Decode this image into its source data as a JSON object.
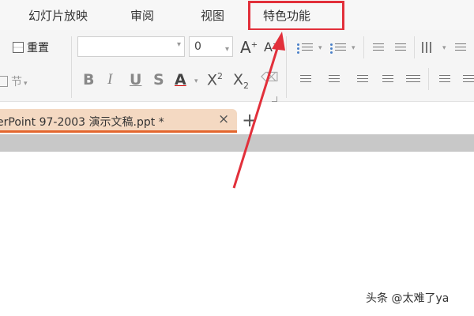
{
  "menu": {
    "tabs": [
      "幻灯片放映",
      "审阅",
      "视图",
      "特色功能"
    ],
    "highlighted_tab_index": 3
  },
  "ribbon": {
    "reset_label": "重置",
    "section_label": "节",
    "font_name": "",
    "font_size": "0",
    "grow_label": "A",
    "shrink_label": "A",
    "bold": "B",
    "italic": "I",
    "underline": "U",
    "strike": "S",
    "font_color": "A",
    "superscript_base": "X",
    "superscript_mark": "2",
    "subscript_base": "X",
    "subscript_mark": "2"
  },
  "document": {
    "tab_title": "erPoint 97-2003 演示文稿.ppt *",
    "close_glyph": "×",
    "new_tab_glyph": "+"
  },
  "watermark": "头条 @太难了ya",
  "colors": {
    "highlight": "#e2303b",
    "tab_accent": "#e3662e",
    "tab_bg": "#f4d9c2"
  }
}
